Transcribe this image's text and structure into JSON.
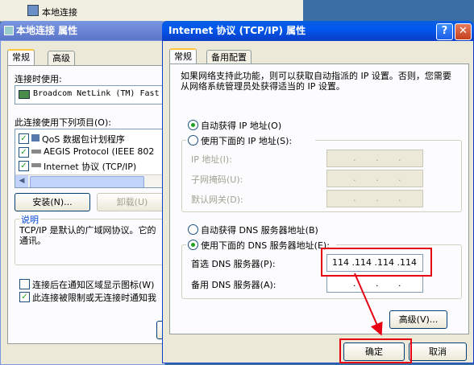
{
  "back_window": {
    "taskbar_title": "本地连接",
    "title": "本地连接 属性",
    "tabs": [
      "常规",
      "高级"
    ],
    "connect_using_label": "连接时使用:",
    "adapter_name": "Broadcom NetLink (TM) Fast",
    "items_label": "此连接使用下列项目(O):",
    "items": [
      {
        "label": "QoS 数据包计划程序",
        "checked": true
      },
      {
        "label": "AEGIS Protocol (IEEE 802",
        "checked": true
      },
      {
        "label": "Internet 协议 (TCP/IP)",
        "checked": true
      }
    ],
    "install_button": "安装(N)...",
    "uninstall_button": "卸载(U)",
    "description_title": "说明",
    "description_text": "TCP/IP 是默认的广域网协议。它的通讯。",
    "show_icon_label": "连接后在通知区域显示图标(W)",
    "notify_label": "此连接被限制或无连接时通知我"
  },
  "dialog": {
    "title": "Internet 协议 (TCP/IP) 属性",
    "help_button": "?",
    "close_button": "✕",
    "tabs": [
      "常规",
      "备用配置"
    ],
    "intro": "如果网络支持此功能，则可以获取自动指派的 IP 设置。否则，您需要从网络系统管理员处获得适当的 IP 设置。",
    "auto_ip_label": "自动获得 IP 地址(O)",
    "manual_ip_label": "使用下面的 IP 地址(S):",
    "ip_address_label": "IP 地址(I):",
    "subnet_label": "子网掩码(U):",
    "gateway_label": "默认网关(D):",
    "auto_dns_label": "自动获得 DNS 服务器地址(B)",
    "manual_dns_label": "使用下面的 DNS 服务器地址(E):",
    "preferred_dns_label": "首选 DNS 服务器(P):",
    "preferred_dns_value": "114 .114 .114 .114",
    "alternate_dns_label": "备用 DNS 服务器(A):",
    "advanced_button": "高级(V)...",
    "ok_button": "确定",
    "cancel_button": "取消",
    "ip_auto_selected": true,
    "dns_manual_selected": true
  },
  "colors": {
    "highlight": "#e60012",
    "title_active": "#0058ee",
    "face": "#ece9d8"
  }
}
